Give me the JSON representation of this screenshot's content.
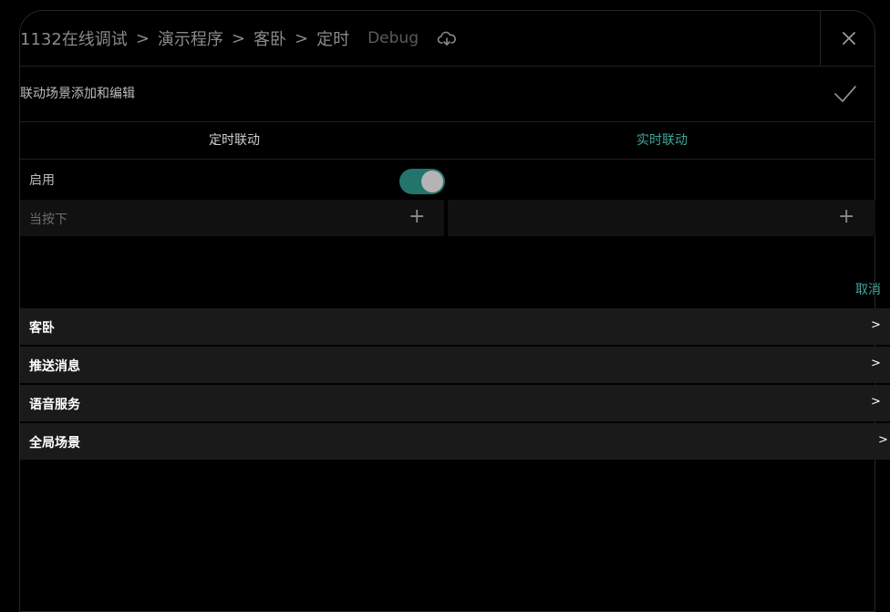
{
  "breadcrumb": {
    "items": [
      "1132在线调试",
      "演示程序",
      "客卧",
      "定时"
    ],
    "separator": ">"
  },
  "header": {
    "debug_label": "Debug"
  },
  "subtitle": "联动场景添加和编辑",
  "tabs": [
    {
      "label": "定时联动",
      "active": true
    },
    {
      "label": "实时联动",
      "active": false
    }
  ],
  "enable": {
    "label": "启用",
    "on": true
  },
  "conditions": {
    "left_label": "当按下",
    "plus": "+"
  },
  "cancel_label": "取消",
  "list": [
    {
      "label": "客卧",
      "arrow": ">"
    },
    {
      "label": "推送消息",
      "arrow": ">"
    },
    {
      "label": "语音服务",
      "arrow": ">"
    },
    {
      "label": "全局场景",
      "arrow": ">"
    }
  ],
  "colors": {
    "accent": "#3fa79a",
    "toggle_on": "#23756c",
    "background": "#000000"
  }
}
